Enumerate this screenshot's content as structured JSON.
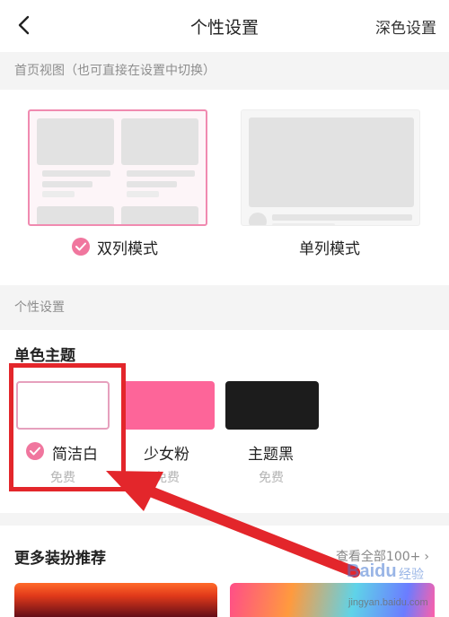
{
  "nav": {
    "title": "个性设置",
    "right_label": "深色设置"
  },
  "home_view": {
    "section_title": "首页视图（也可直接在设置中切换）",
    "options": [
      {
        "label": "双列模式",
        "selected": true
      },
      {
        "label": "单列模式",
        "selected": false
      }
    ]
  },
  "personal": {
    "section_title": "个性设置",
    "theme_heading": "单色主题",
    "themes": [
      {
        "name": "简洁白",
        "price": "免费",
        "color": "#ffffff",
        "selected": true
      },
      {
        "name": "少女粉",
        "price": "免费",
        "color": "#fd6599",
        "selected": false
      },
      {
        "name": "主题黑",
        "price": "免费",
        "color": "#1c1c1c",
        "selected": false
      }
    ]
  },
  "more": {
    "title": "更多装扮推荐",
    "link": "查看全部100+"
  },
  "watermark": {
    "logo": "Baidu",
    "text": "经验",
    "url": "jingyan.baidu.com"
  },
  "colors": {
    "accent": "#f0769e",
    "annotation": "#e3262b"
  }
}
